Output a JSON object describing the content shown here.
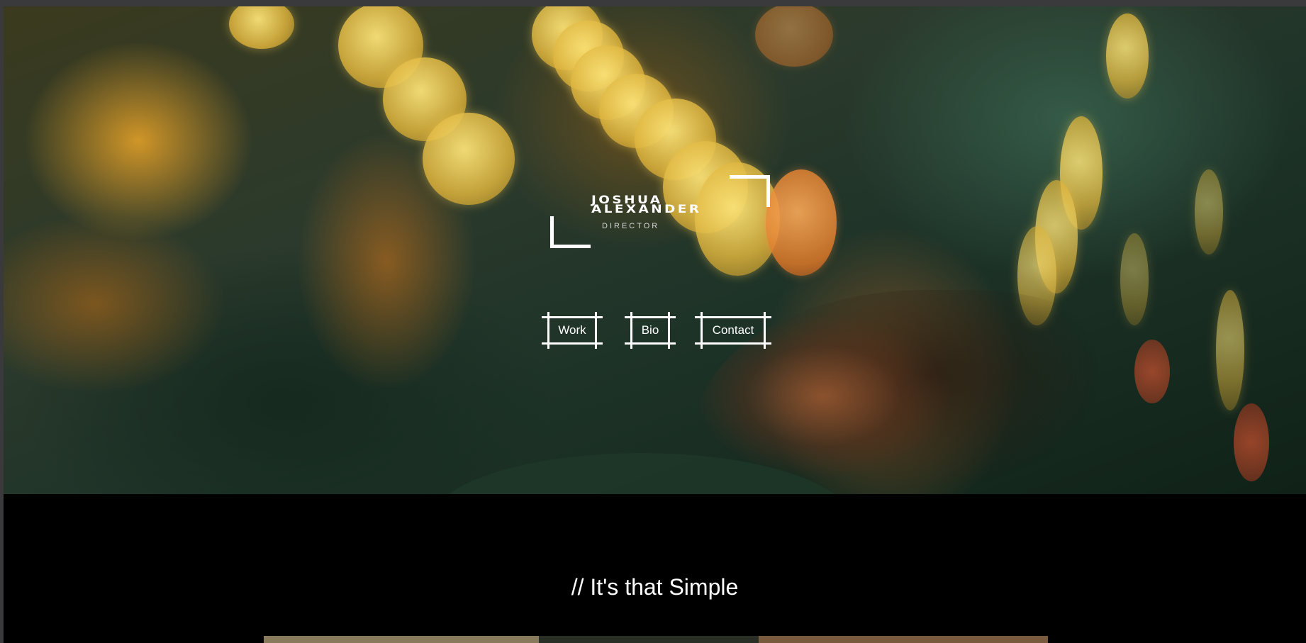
{
  "hero": {
    "logo": {
      "first_name": "JOSHUA",
      "last_name": "ALEXANDER",
      "role": "DIRECTOR"
    },
    "nav": [
      {
        "label": "Work"
      },
      {
        "label": "Bio"
      },
      {
        "label": "Contact"
      }
    ]
  },
  "section": {
    "tagline": "// It's that Simple"
  },
  "colors": {
    "frame_bg": "#3a3a3c",
    "section_bg": "#000000",
    "text": "#ffffff"
  }
}
